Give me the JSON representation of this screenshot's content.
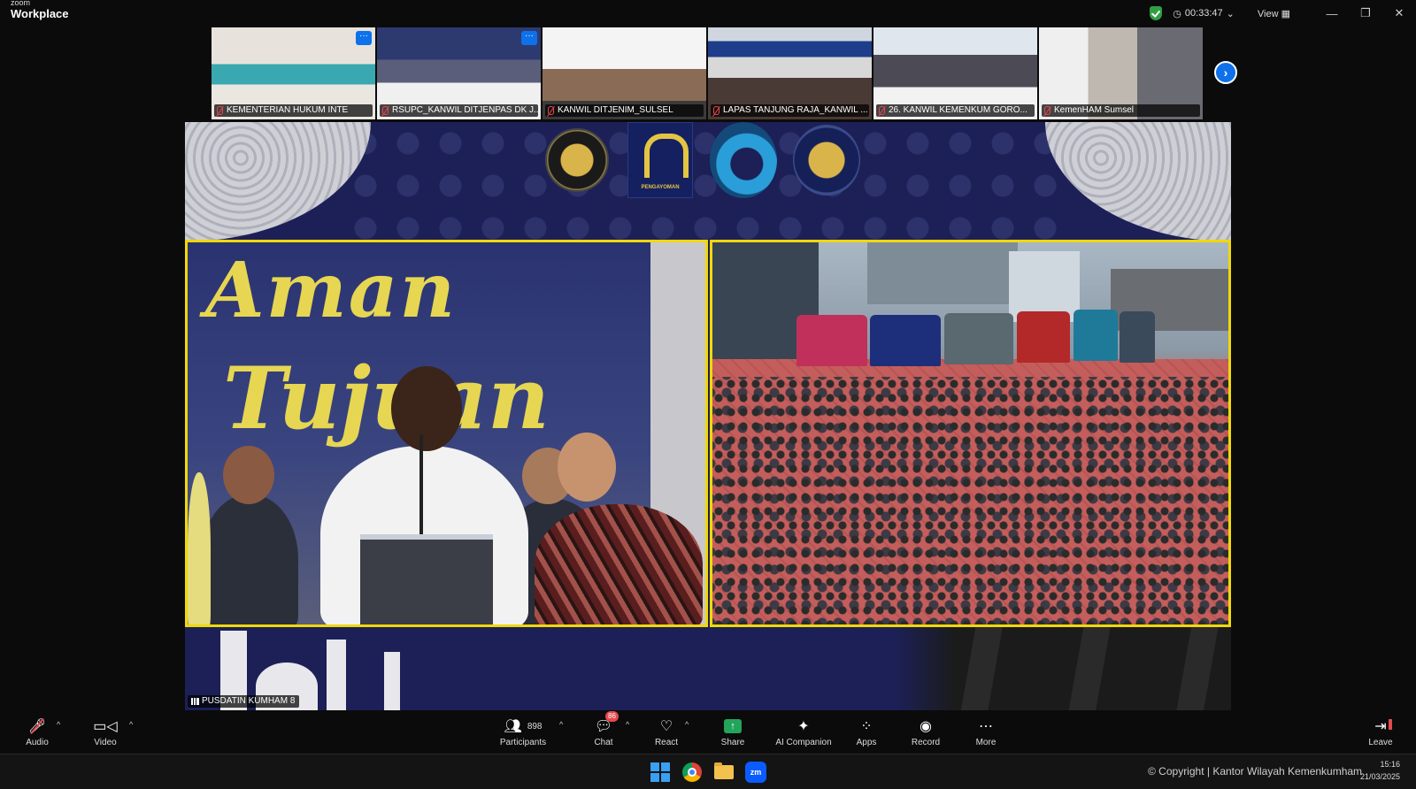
{
  "app": {
    "brand_top": "zoom",
    "brand_name": "Workplace",
    "meeting_timer": "00:33:47",
    "view_label": "View",
    "window_controls": [
      "minimize-icon",
      "restore-icon",
      "close-icon"
    ]
  },
  "gallery": {
    "tiles": [
      {
        "name": "KEMENTERIAN HUKUM INTE",
        "muted": true,
        "has_menu": true
      },
      {
        "name": "RSUPC_KANWIL DITJENPAS DK J...",
        "muted": true,
        "has_menu": true
      },
      {
        "name": "KANWIL DITJENIM_SULSEL",
        "muted": true,
        "has_menu": false
      },
      {
        "name": "LAPAS TANJUNG RAJA_KANWIL ...",
        "muted": true,
        "has_menu": false
      },
      {
        "name": "26. KANWIL KEMENKUM GORO...",
        "muted": true,
        "has_menu": false
      },
      {
        "name": "KemenHAM Sumsel",
        "muted": true,
        "has_menu": false
      }
    ],
    "more_button_glyph": "›",
    "menu_glyph": "···"
  },
  "stage": {
    "script_word_1": "Aman",
    "script_word_2": "Tujuan",
    "logo_caption": "PENGAYOMAN",
    "speaker_label": "PUSDATIN KUMHAM 8",
    "colors": {
      "frame": "#f0d80a",
      "backdrop": "#1c2057"
    }
  },
  "toolbar": {
    "audio": "Audio",
    "video": "Video",
    "participants": "Participants",
    "participants_count": "898",
    "chat": "Chat",
    "chat_badge": "86",
    "react": "React",
    "share": "Share",
    "ai_companion": "AI Companion",
    "apps": "Apps",
    "record": "Record",
    "more": "More",
    "leave": "Leave"
  },
  "taskbar": {
    "copyright": "© Copyright | Kantor Wilayah Kemenkumham",
    "time": "15:16",
    "date": "21/03/2025",
    "icons": [
      "windows-start-icon",
      "chrome-icon",
      "file-explorer-icon",
      "zoom-app-icon"
    ]
  }
}
